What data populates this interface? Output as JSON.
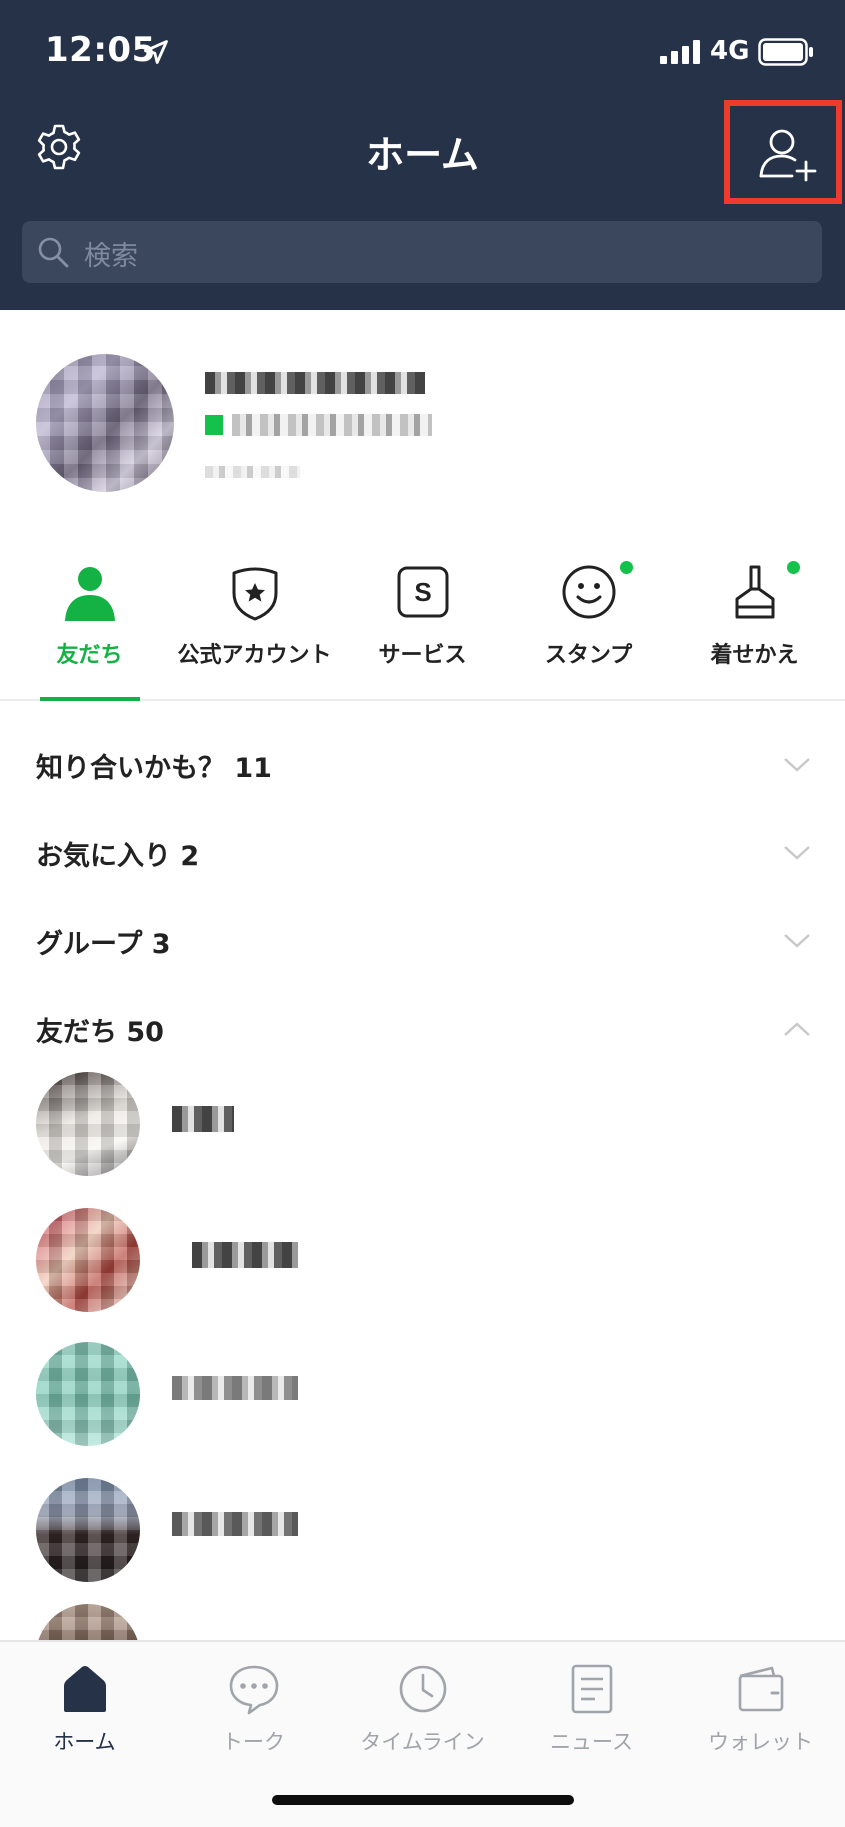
{
  "status_bar": {
    "time": "12:05",
    "network": "4G"
  },
  "header": {
    "title": "ホーム"
  },
  "search": {
    "placeholder": "検索"
  },
  "tabs": [
    {
      "label": "友だち",
      "icon": "person-icon",
      "active": true
    },
    {
      "label": "公式アカウント",
      "icon": "shield-star-icon"
    },
    {
      "label": "サービス",
      "icon": "service-s-icon"
    },
    {
      "label": "スタンプ",
      "icon": "smiley-icon",
      "badge": true
    },
    {
      "label": "着せかえ",
      "icon": "brush-icon",
      "badge": true
    }
  ],
  "sections": [
    {
      "title": "知り合いかも？ 11",
      "expanded": false
    },
    {
      "title": "お気に入り 2",
      "expanded": false
    },
    {
      "title": "グループ 3",
      "expanded": false
    },
    {
      "title": "友だち 50",
      "expanded": true
    }
  ],
  "bottom_nav": [
    {
      "label": "ホーム",
      "icon": "home-icon",
      "active": true
    },
    {
      "label": "トーク",
      "icon": "chat-bubble-icon"
    },
    {
      "label": "タイムライン",
      "icon": "clock-icon"
    },
    {
      "label": "ニュース",
      "icon": "news-document-icon"
    },
    {
      "label": "ウォレット",
      "icon": "wallet-icon"
    }
  ],
  "colors": {
    "header_bg": "#263248",
    "accent_green": "#14b144",
    "highlight_red": "#ef3b2b"
  }
}
